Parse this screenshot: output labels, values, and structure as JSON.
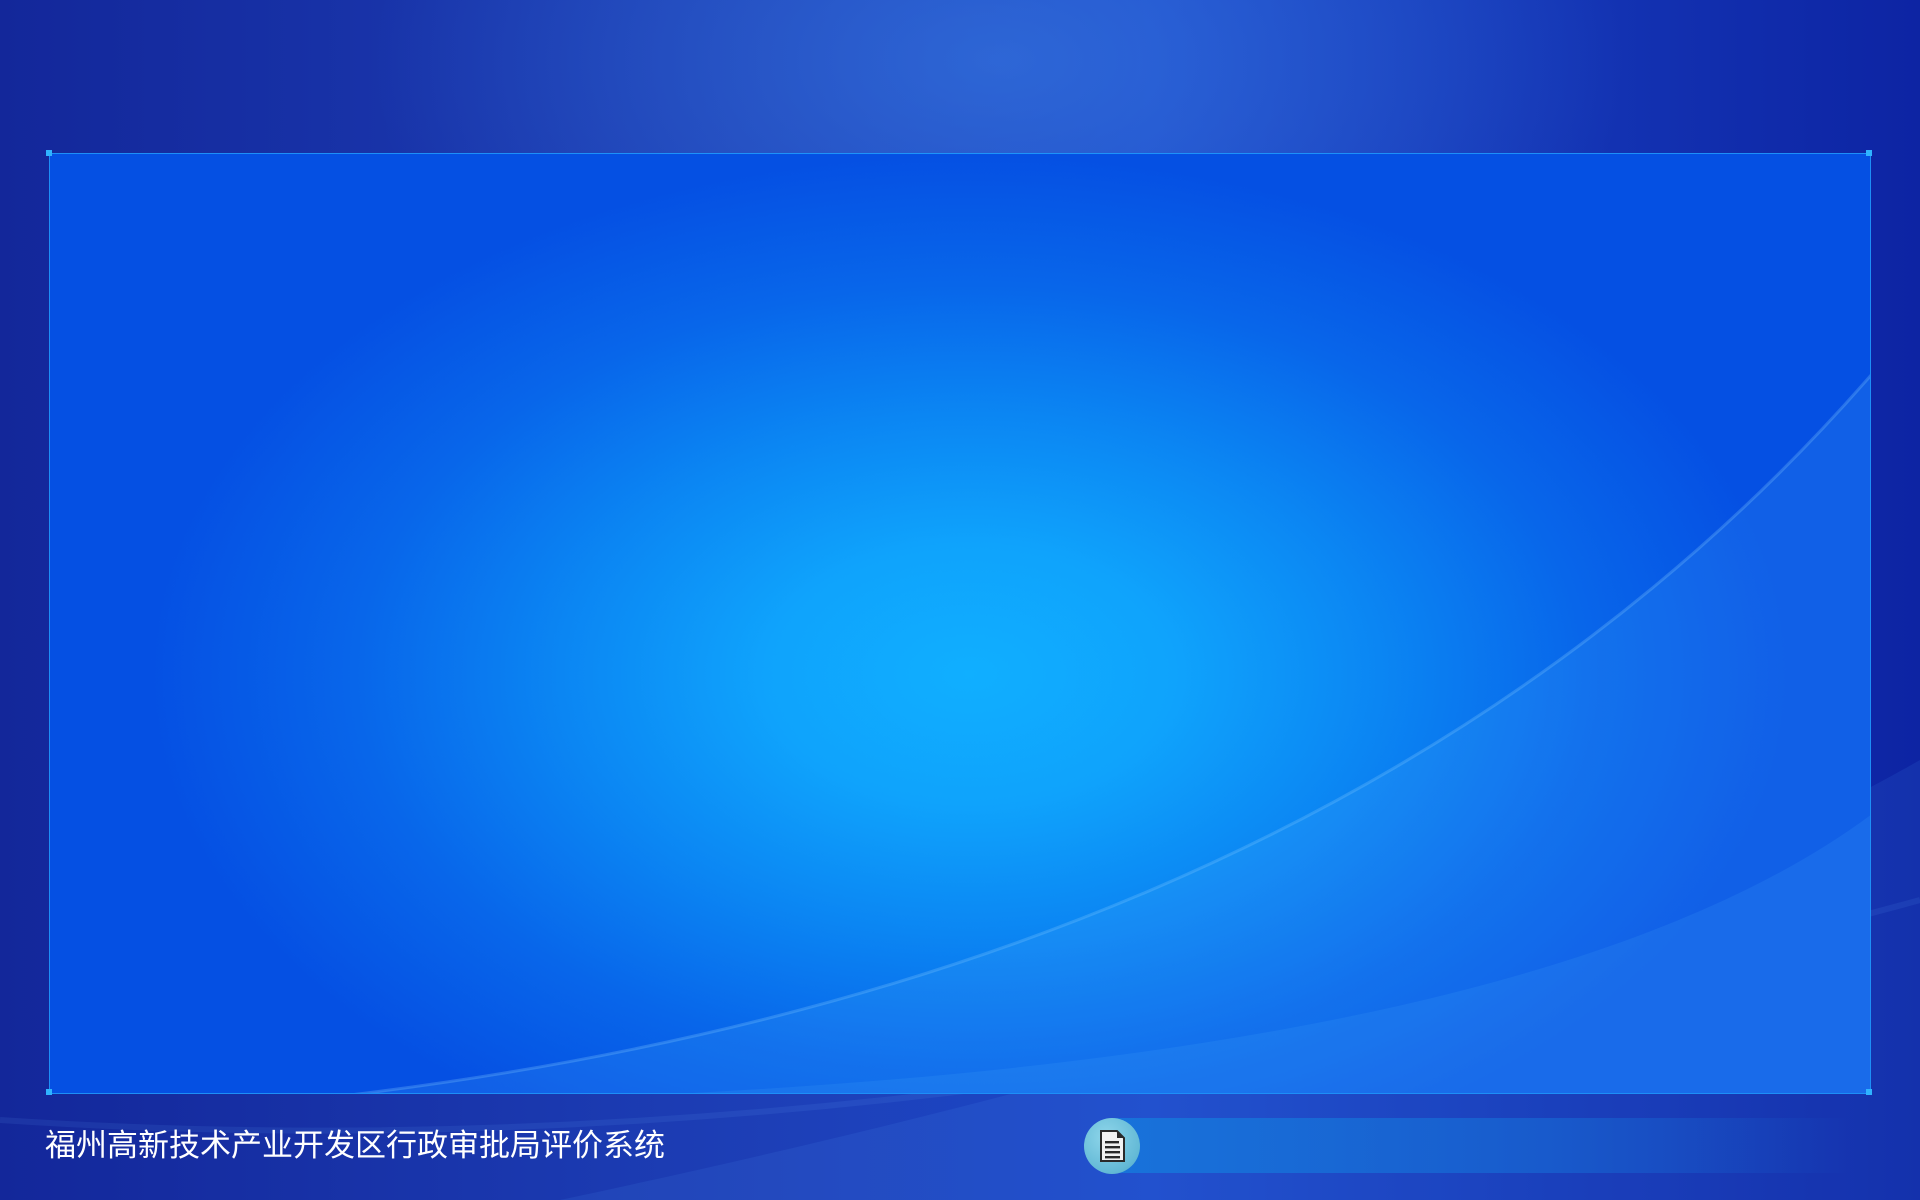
{
  "footer": {
    "system_title": "福州高新技术产业开发区行政审批局评价系统",
    "doc_button_icon": "document-icon"
  },
  "colors": {
    "page_background": "#1a3cb3",
    "panel_center": "#10afff",
    "panel_edge": "#0550e3",
    "panel_border": "#2fb3ff",
    "footer_text": "#ffffff",
    "doc_button": "#63b9d6"
  }
}
